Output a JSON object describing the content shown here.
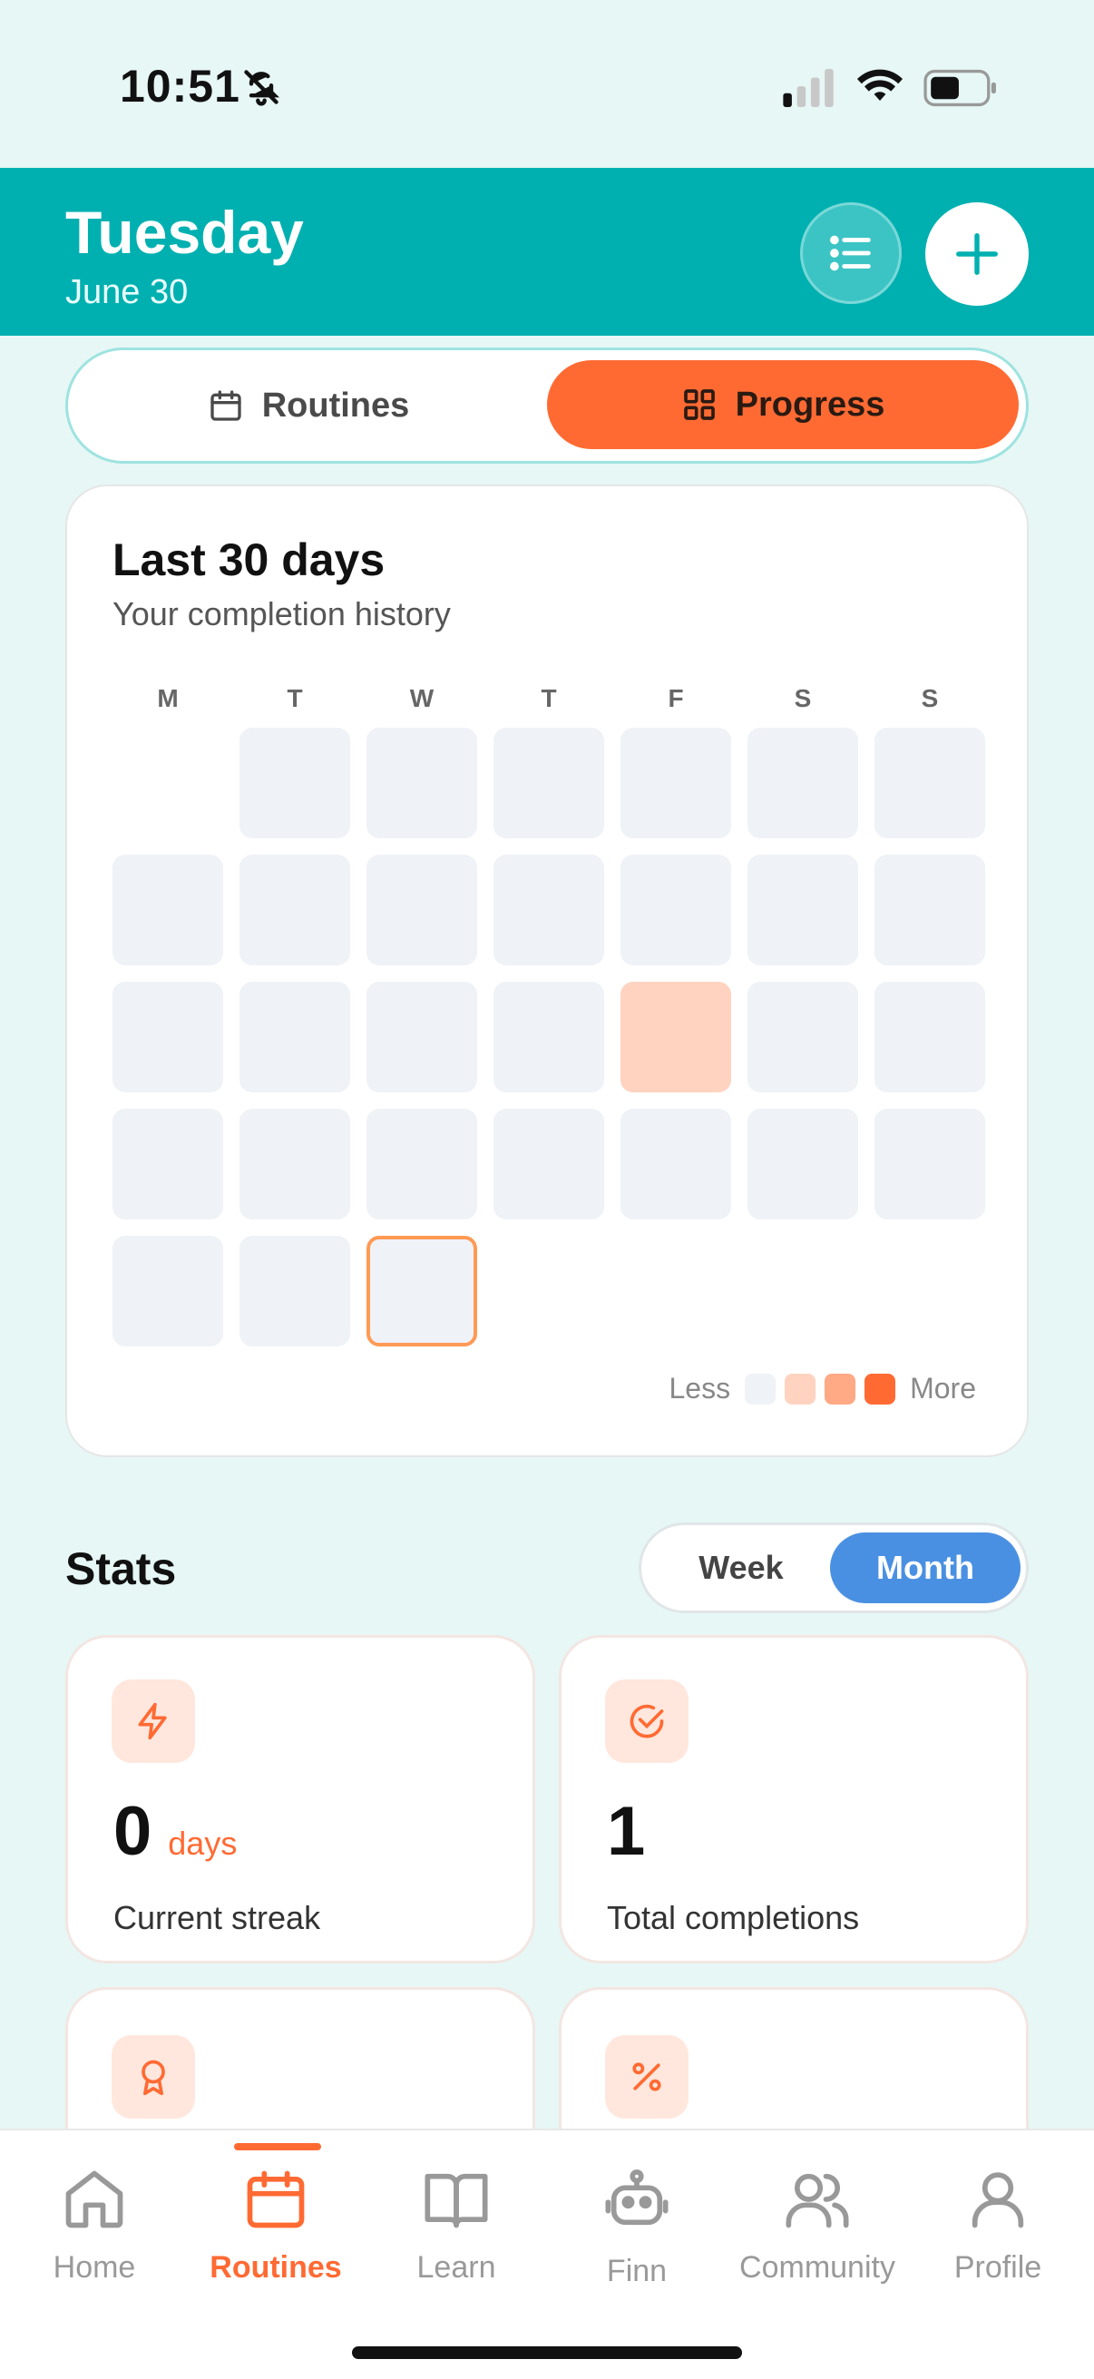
{
  "status": {
    "time": "10:51"
  },
  "header": {
    "day": "Tuesday",
    "date": "June 30"
  },
  "segment": {
    "routines": "Routines",
    "progress": "Progress"
  },
  "history": {
    "title": "Last 30 days",
    "subtitle": "Your completion history",
    "weekdays": [
      "M",
      "T",
      "W",
      "T",
      "F",
      "S",
      "S"
    ],
    "legend": {
      "less": "Less",
      "more": "More",
      "colors": [
        "#eff2f6",
        "#ffd3c0",
        "#ffa985",
        "#ff6a33"
      ]
    },
    "first_day_offset": 1,
    "days": [
      0,
      0,
      0,
      0,
      0,
      0,
      0,
      0,
      0,
      0,
      0,
      0,
      0,
      0,
      0,
      0,
      0,
      1,
      0,
      0,
      0,
      0,
      0,
      0,
      0,
      0,
      0,
      0,
      0,
      0
    ],
    "today_index": 29
  },
  "stats": {
    "title": "Stats",
    "toggle": {
      "week": "Week",
      "month": "Month",
      "selected": "Month"
    },
    "cards": [
      {
        "icon": "lightning-icon",
        "value": "0",
        "unit": "days",
        "label": "Current streak"
      },
      {
        "icon": "check-circle-icon",
        "value": "1",
        "unit": "",
        "label": "Total completions"
      },
      {
        "icon": "award-icon"
      },
      {
        "icon": "percent-icon"
      }
    ]
  },
  "tabs": [
    {
      "label": "Home",
      "icon": "home-icon"
    },
    {
      "label": "Routines",
      "icon": "calendar-icon",
      "active": true
    },
    {
      "label": "Learn",
      "icon": "book-icon"
    },
    {
      "label": "Finn",
      "icon": "robot-icon"
    },
    {
      "label": "Community",
      "icon": "users-icon"
    },
    {
      "label": "Profile",
      "icon": "user-icon"
    }
  ],
  "colors": {
    "teal": "#00b0b0",
    "accent": "#ff6a33",
    "blue": "#4a90e2",
    "background": "#e6f7f5"
  }
}
